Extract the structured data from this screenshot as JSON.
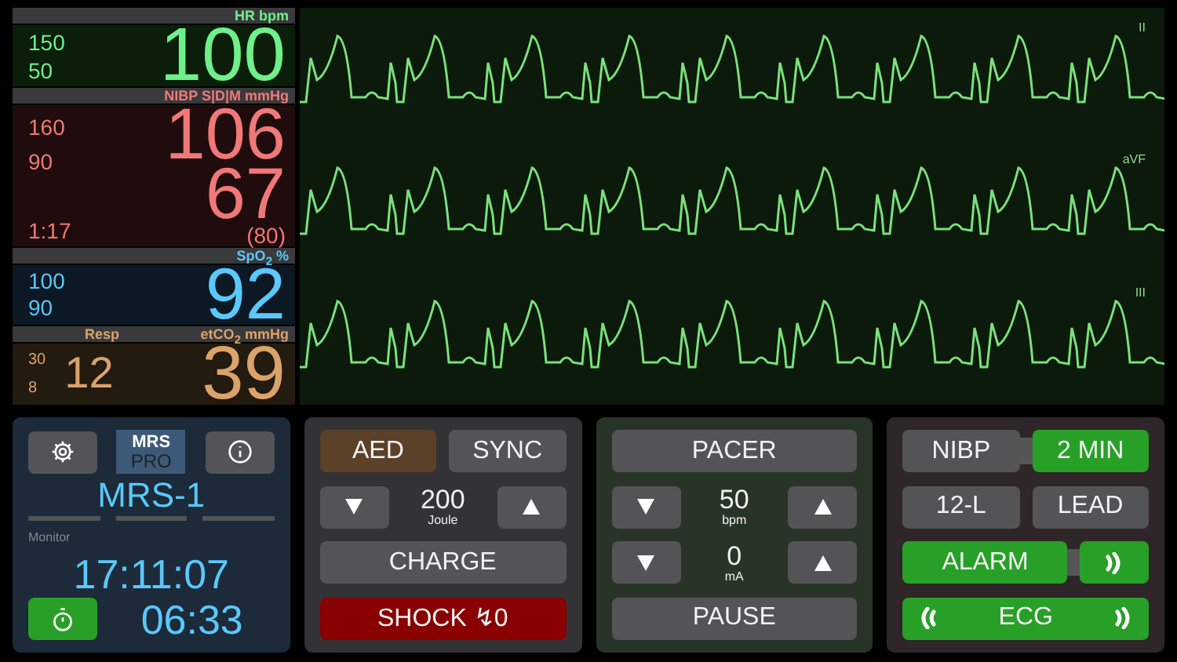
{
  "vitals": [
    {
      "kind": "hr",
      "label": "HR  bpm",
      "color": "#6ff08a",
      "limits": [
        "150",
        "50"
      ],
      "values": [
        "100"
      ]
    },
    {
      "kind": "nibp",
      "label": "NIBP S|D|M  mmHg",
      "color": "#f07878",
      "limits": [
        "160",
        "90"
      ],
      "values": [
        "106",
        "67"
      ],
      "time": "1:17",
      "mean": "(80)"
    },
    {
      "kind": "spo2",
      "label": "SpO$_{2}$  %",
      "color": "#5ac8fa",
      "limits": [
        "100",
        "90"
      ],
      "values": [
        "92"
      ]
    },
    {
      "kind": "etco2",
      "label": "etCO$_{2}$  mmHg",
      "sub_label": "Resp",
      "color": "#d9a36a",
      "limits": [
        "30",
        "8"
      ],
      "sub_value": "12",
      "values": [
        "39"
      ]
    }
  ],
  "leads": [
    "II",
    "aVF",
    "III"
  ],
  "monitor": {
    "logo": [
      "MRS",
      "PRO"
    ],
    "device": "MRS-1",
    "mode": "Monitor",
    "clock": "17:11:07",
    "timer": "06:33",
    "timer_on": true
  },
  "defib": {
    "modes": [
      {
        "label": "AED",
        "selected": true
      },
      {
        "label": "SYNC",
        "selected": false
      }
    ],
    "energy": "200",
    "energy_unit": "Joule",
    "charge": "CHARGE",
    "shock": "SHOCK ↯0"
  },
  "pacer": {
    "title": "PACER",
    "settings": [
      {
        "value": "50",
        "unit": "bpm"
      },
      {
        "value": "0",
        "unit": "mA"
      }
    ],
    "pause": "PAUSE"
  },
  "controls": {
    "nibp": "NIBP",
    "interval": {
      "label": "2 MIN",
      "on": true
    },
    "twelve_lead": "12-L",
    "lead": "LEAD",
    "alarm": {
      "label": "ALARM",
      "on": true
    },
    "ecg": {
      "label": "ECG",
      "on": true
    }
  }
}
